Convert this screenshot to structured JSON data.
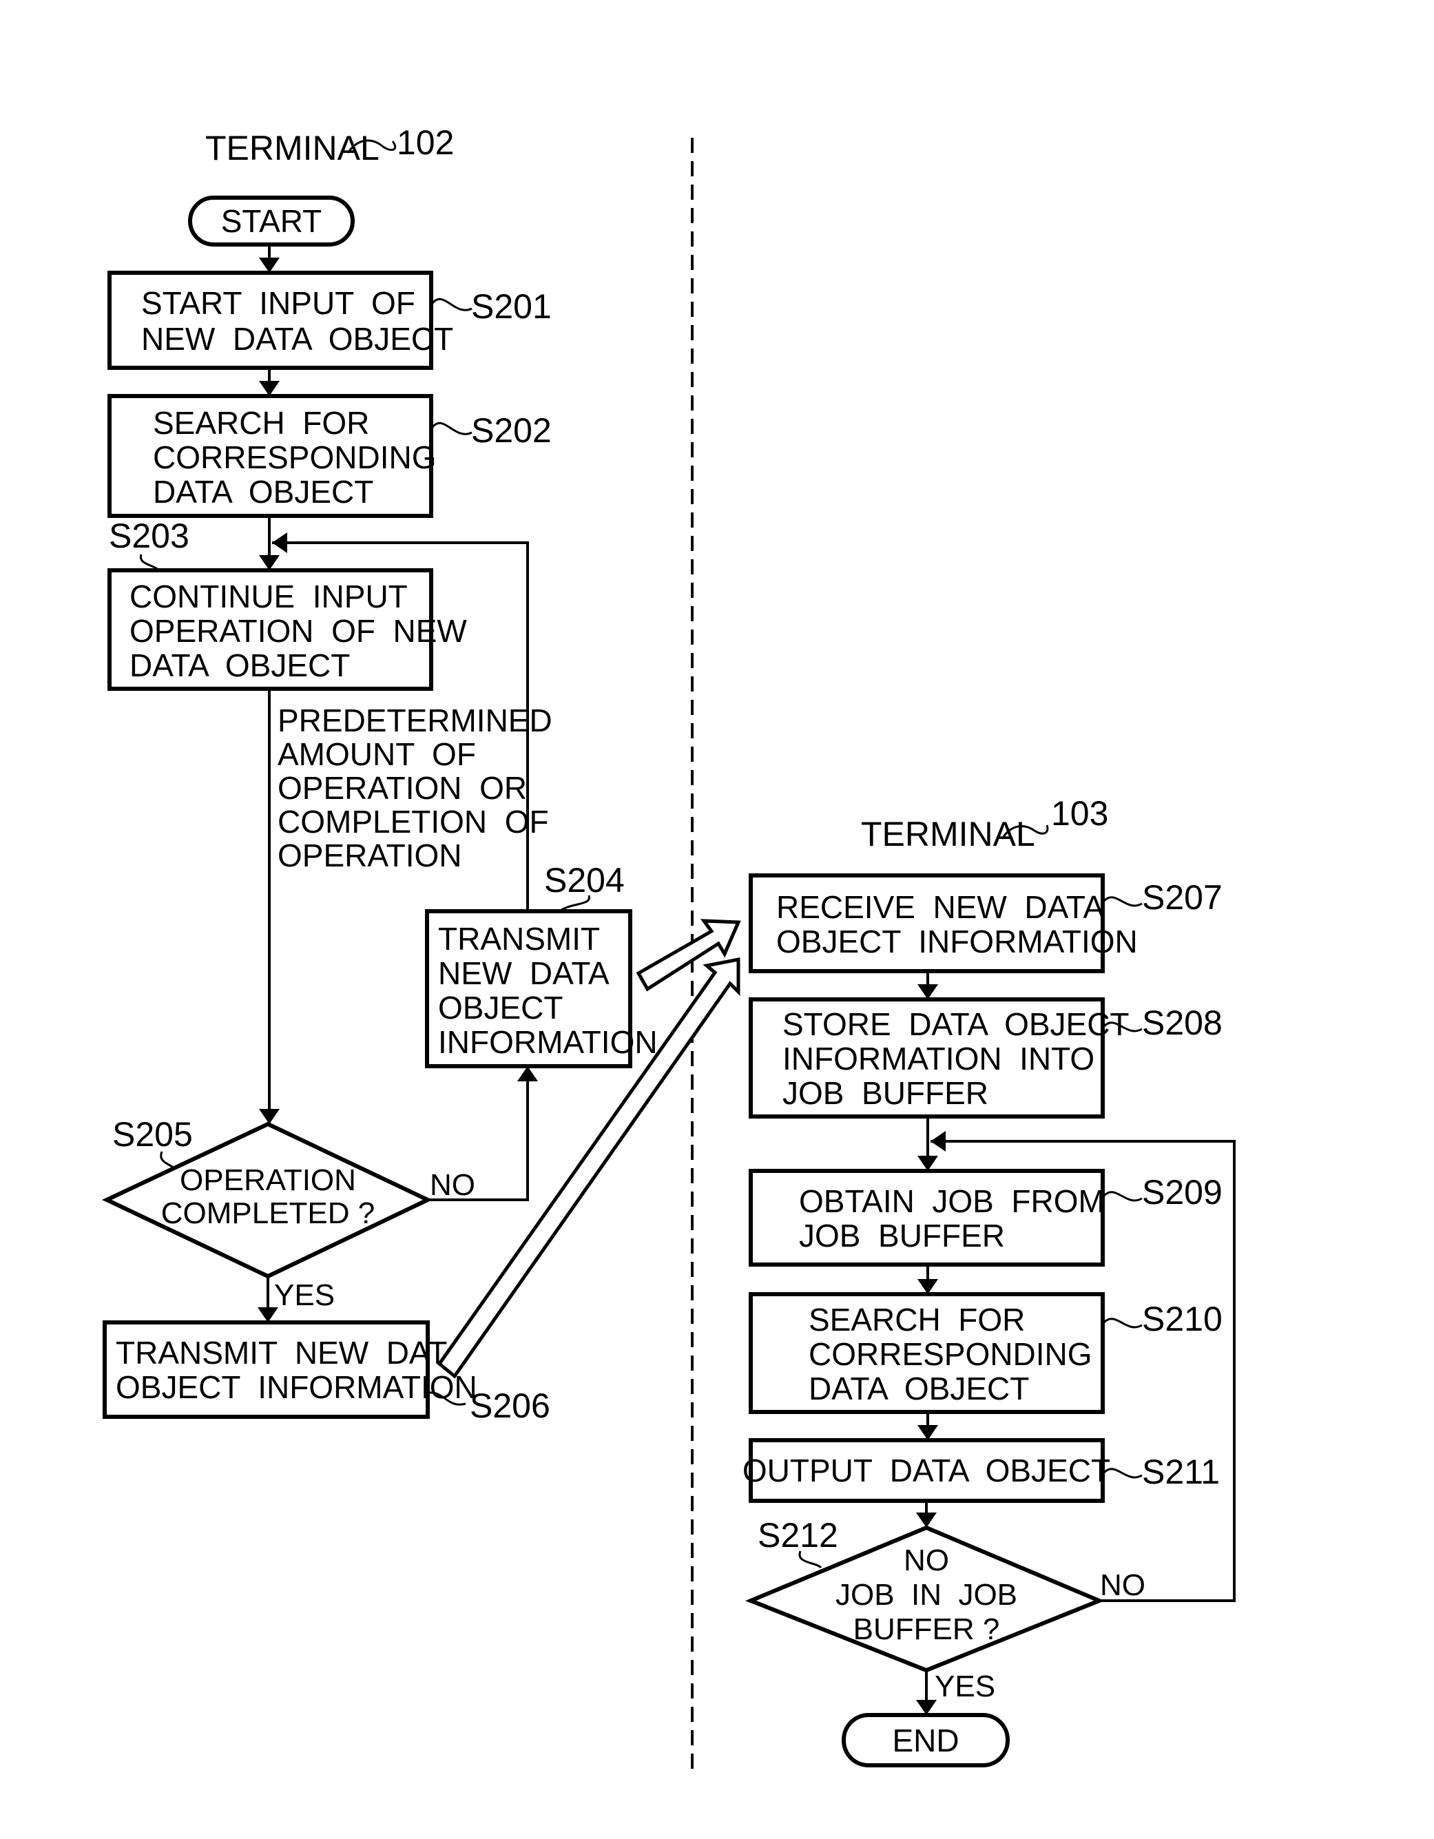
{
  "terminals": {
    "left": {
      "label": "TERMINAL",
      "ref": "102"
    },
    "right": {
      "label": "TERMINAL",
      "ref": "103"
    }
  },
  "start": {
    "label": "START"
  },
  "end": {
    "label": "END"
  },
  "steps": {
    "S201": {
      "id": "S201",
      "lines": [
        "START  INPUT  OF",
        "NEW  DATA  OBJECT"
      ]
    },
    "S202": {
      "id": "S202",
      "lines": [
        "SEARCH  FOR",
        "CORRESPONDING",
        "DATA  OBJECT"
      ]
    },
    "S203": {
      "id": "S203",
      "lines": [
        "CONTINUE  INPUT",
        "OPERATION  OF  NEW",
        "DATA  OBJECT"
      ]
    },
    "S204": {
      "id": "S204",
      "lines": [
        "TRANSMIT",
        "NEW  DATA",
        "OBJECT",
        "INFORMATION"
      ]
    },
    "S205": {
      "id": "S205",
      "lines": [
        "OPERATION",
        "COMPLETED ?"
      ]
    },
    "S206": {
      "id": "S206",
      "lines": [
        "TRANSMIT  NEW  DATA",
        "OBJECT  INFORMATION"
      ]
    },
    "S207": {
      "id": "S207",
      "lines": [
        "RECEIVE  NEW  DATA",
        "OBJECT  INFORMATION"
      ]
    },
    "S208": {
      "id": "S208",
      "lines": [
        "STORE  DATA  OBJECT",
        "INFORMATION  INTO",
        "JOB  BUFFER"
      ]
    },
    "S209": {
      "id": "S209",
      "lines": [
        "OBTAIN  JOB  FROM",
        "JOB  BUFFER"
      ]
    },
    "S210": {
      "id": "S210",
      "lines": [
        "SEARCH  FOR",
        "CORRESPONDING",
        "DATA  OBJECT"
      ]
    },
    "S211": {
      "id": "S211",
      "lines": [
        "OUTPUT  DATA  OBJECT"
      ]
    },
    "S212": {
      "id": "S212",
      "lines": [
        "NO",
        "JOB  IN  JOB",
        "BUFFER ?"
      ]
    }
  },
  "condition_note": {
    "lines": [
      "PREDETERMINED",
      "AMOUNT  OF",
      "OPERATION  OR",
      "COMPLETION  OF",
      "OPERATION"
    ]
  },
  "branches": {
    "s205_no": "NO",
    "s205_yes": "YES",
    "s212_no": "NO",
    "s212_yes": "YES"
  }
}
